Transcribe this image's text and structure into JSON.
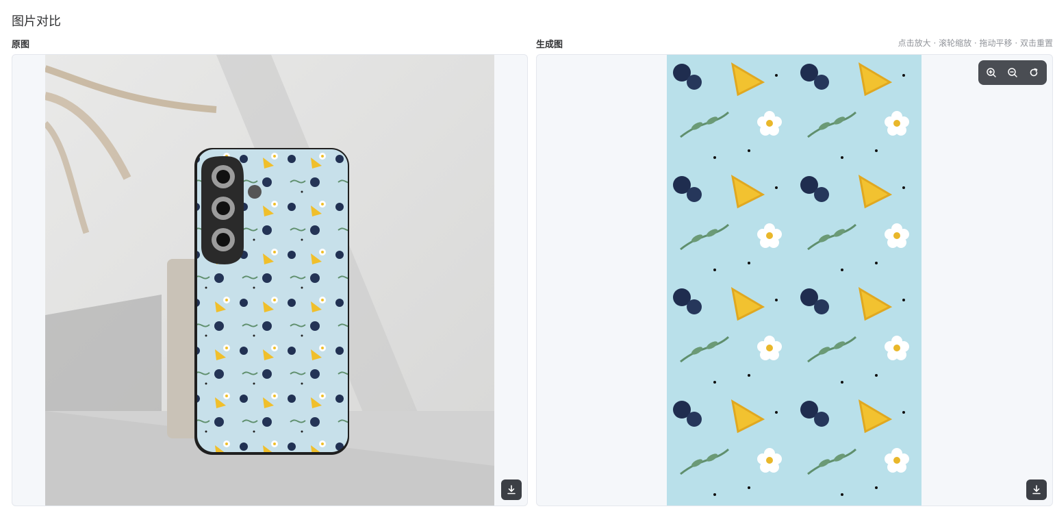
{
  "page": {
    "title": "图片对比"
  },
  "original": {
    "label": "原图"
  },
  "generated": {
    "label": "生成图",
    "hint": "点击放大 · 滚轮缩放 · 拖动平移 · 双击重置"
  },
  "icons": {
    "zoom_in": "zoom-in-icon",
    "zoom_out": "zoom-out-icon",
    "reset": "reset-icon",
    "download": "download-icon"
  },
  "colors": {
    "panel_bg": "#f5f7fa",
    "toolbar_bg": "#4a4d53",
    "pattern_bg": "#b9e0ea",
    "lemon": "#f2c230",
    "blueberry": "#1f2d4f",
    "leaf": "#5f8f6d",
    "flower": "#ffffff"
  }
}
